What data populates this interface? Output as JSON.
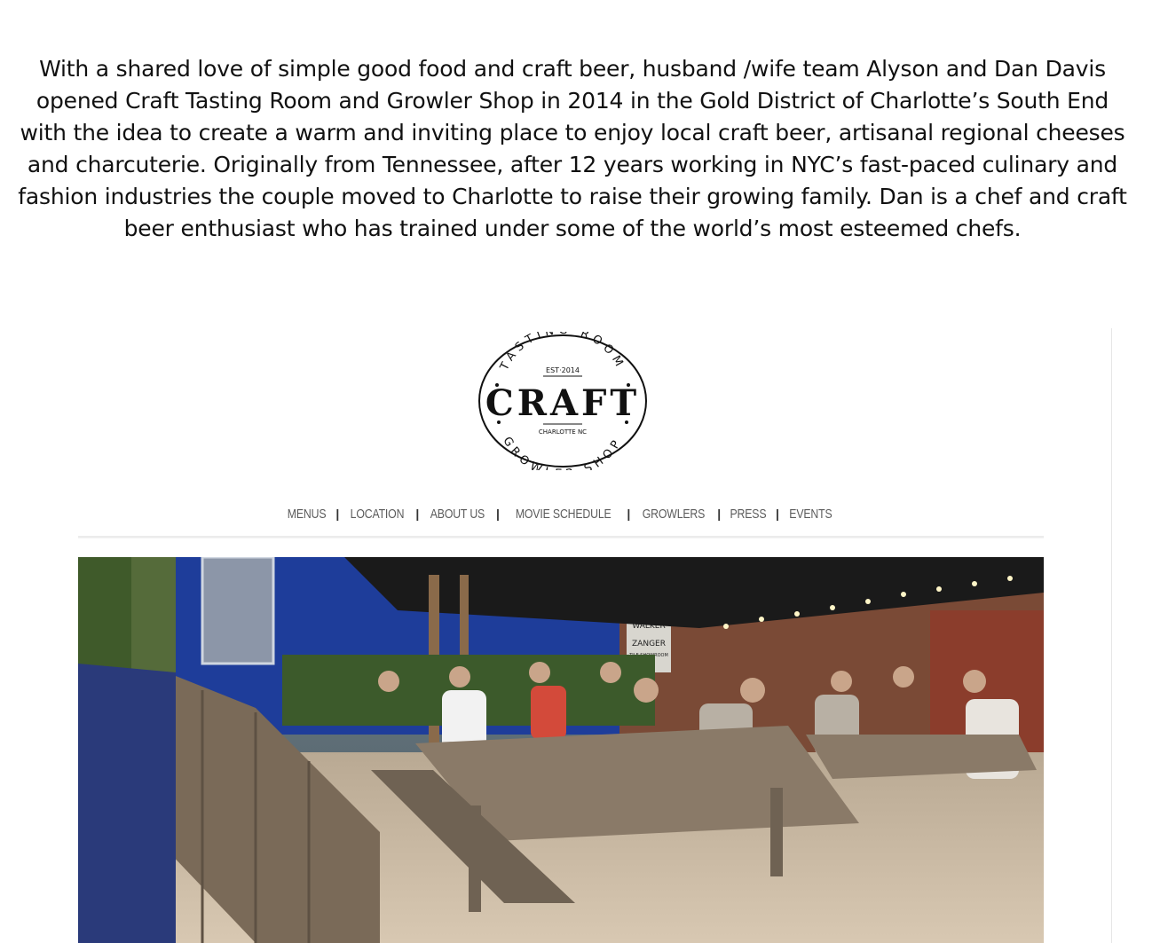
{
  "intro": {
    "text": "With a shared love of simple good food and craft beer, husband /wife team Alyson and Dan Davis opened Craft Tasting Room and Growler Shop in 2014 in the Gold District of Charlotte’s South End with the idea to create a warm and inviting place to enjoy local craft beer, artisanal regional cheeses and charcuterie. Originally from Tennessee, after 12 years working in NYC’s fast-paced culinary and fashion industries the couple moved to Charlotte to raise their growing family. Dan is a chef and craft beer enthusiast who has trained under some of the world’s most esteemed chefs."
  },
  "logo": {
    "top_arc": "TASTING ROOM",
    "est": "EST",
    "year": "2014",
    "name": "CRAFT",
    "city": "CHARLOTTE NC",
    "bottom_arc": "GROWLER SHOP"
  },
  "nav": {
    "items": [
      {
        "label": "MENUS"
      },
      {
        "label": "LOCATION"
      },
      {
        "label": "ABOUT US"
      },
      {
        "label": "MOVIE SCHEDULE"
      },
      {
        "label": "GROWLERS"
      },
      {
        "label": "PRESS"
      },
      {
        "label": "EVENTS"
      }
    ],
    "separator": "|"
  },
  "hero": {
    "sign_line1": "WALKER",
    "sign_line2": "ZANGER",
    "sign_line3": "TILE SHOWROOM"
  },
  "colors": {
    "nav_text": "#5b5b5b",
    "wall_blue": "#1e3d9a",
    "canopy": "#1a1a1a",
    "gravel": "#c9b8a3",
    "wood": "#8a7a68"
  }
}
